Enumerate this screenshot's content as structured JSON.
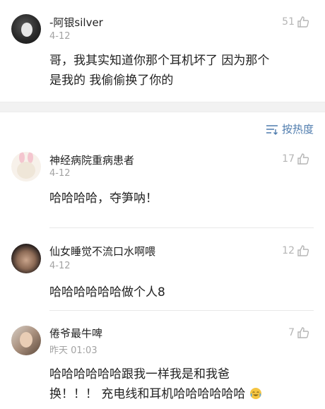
{
  "main_comment": {
    "username": "-阿银silver",
    "date": "4-12",
    "likes": "51",
    "text_line1": "哥，我其实知道你那个耳机坏了 因为那个",
    "text_line2": "是我的 我偷偷换了你的"
  },
  "sort": {
    "label": "按热度",
    "icon": "sort-lines-icon"
  },
  "replies": [
    {
      "username": "神经病院重病患者",
      "date": "4-12",
      "likes": "17",
      "text_line1": "哈哈哈哈，夺笋呐！"
    },
    {
      "username": "仙女睡觉不流口水啊喂",
      "date": "4-12",
      "likes": "12",
      "text_line1": "哈哈哈哈哈哈做个人8"
    },
    {
      "username": "倦爷最牛啤",
      "date": "昨天 01:03",
      "likes": "7",
      "text_line1": "哈哈哈哈哈哈跟我一样我是和我爸",
      "text_line2": "换！！！ 充电线和耳机哈哈哈哈哈哈"
    }
  ],
  "colors": {
    "accent": "#4f7cae",
    "meta": "#a3a3a3",
    "separator": "#f2f2f2"
  }
}
